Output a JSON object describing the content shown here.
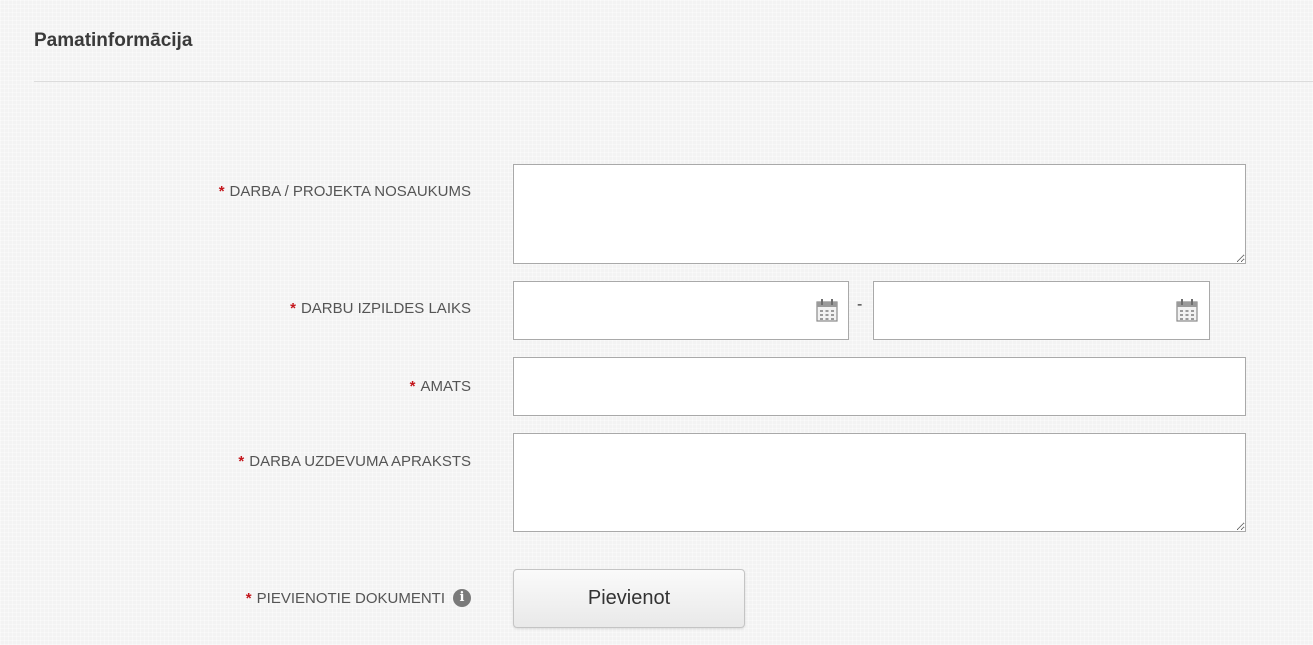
{
  "section": {
    "title": "Pamatinformācija"
  },
  "required_marker": "*",
  "fields": {
    "project_name": {
      "label": "DARBA / PROJEKTA NOSAUKUMS",
      "value": ""
    },
    "work_period": {
      "label": "DARBU IZPILDES LAIKS",
      "start_value": "",
      "end_value": "",
      "separator": "-"
    },
    "position": {
      "label": "AMATS",
      "value": ""
    },
    "task_description": {
      "label": "DARBA UZDEVUMA APRAKSTS",
      "value": ""
    },
    "documents": {
      "label": "PIEVIENOTIE DOKUMENTI",
      "info_icon": "info-circle-icon",
      "info_glyph": "i",
      "button_label": "Pievienot"
    }
  },
  "icons": {
    "date_picker": "calendar-icon"
  },
  "colors": {
    "required": "#c4161c",
    "label_text": "#555555",
    "input_border": "#a9a9a9"
  }
}
